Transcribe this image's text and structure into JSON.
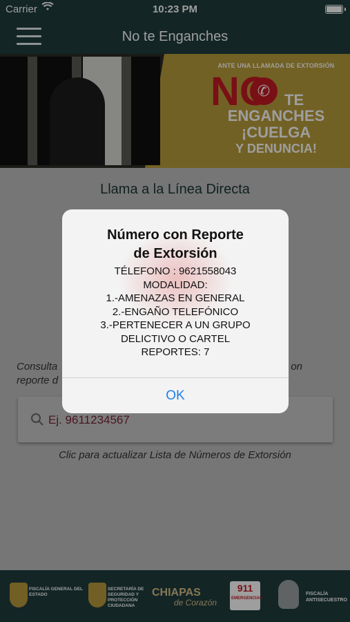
{
  "status_bar": {
    "carrier": "Carrier",
    "time": "10:23 PM"
  },
  "nav": {
    "title": "No te Enganches"
  },
  "banner": {
    "subtitle": "ANTE UNA LLAMADA DE EXTORSIÓN",
    "no": "NO",
    "te": "TE",
    "enganches": "ENGANCHES",
    "cuelga": "¡CUELGA",
    "denuncia": "Y DENUNCIA!"
  },
  "main": {
    "title": "Llama a la Línea Directa",
    "consulta_left": "Consulta",
    "consulta_right": "on",
    "consulta_line2": "reporte d",
    "search_placeholder": "Ej. 9611234567",
    "update_link": "Clic para actualizar Lista de Números de Extorsión"
  },
  "footer": {
    "logo1": "FISCALÍA GENERAL DEL ESTADO",
    "logo2": "SECRETARÍA DE SEGURIDAD Y PROTECCIÓN CIUDADANA",
    "logo3_line1": "CHIAPAS",
    "logo3_line2": "de Corazón",
    "logo4_number": "911",
    "logo4_label": "EMERGENCIAS",
    "logo5": "FISCALÍA ANTISECUESTRO"
  },
  "alert": {
    "title_line1": "Número con Reporte",
    "title_line2": "de Extorsión",
    "lines": [
      "TÉLEFONO : 9621558043",
      "MODALIDAD:",
      "1.-AMENAZAS EN GENERAL",
      "2.-ENGAÑO TELEFÓNICO",
      "3.-PERTENECER A UN GRUPO",
      "DELICTIVO O CARTEL",
      "REPORTES: 7"
    ],
    "ok_label": "OK"
  },
  "colors": {
    "nav_bg": "#1f3c3c",
    "accent_red": "#c41a24",
    "ios_blue": "#1e7ef0",
    "banner_gold": "#b99d3a"
  }
}
